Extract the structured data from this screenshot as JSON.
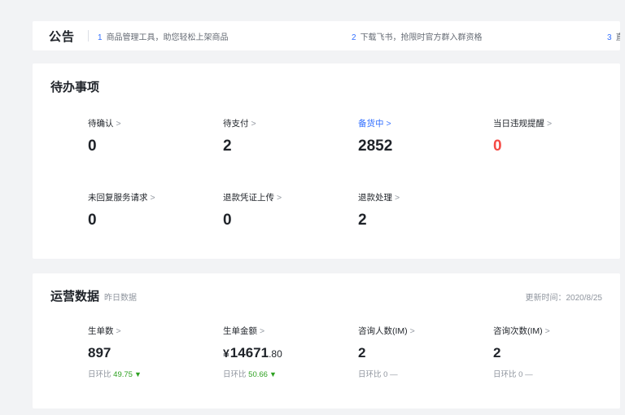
{
  "notice": {
    "title": "公告",
    "items": [
      {
        "num": "1",
        "text": "商品管理工具，助您轻松上架商品"
      },
      {
        "num": "2",
        "text": "下载飞书，抢限时官方群入群资格"
      },
      {
        "num": "3",
        "text": "直"
      }
    ]
  },
  "todo": {
    "title": "待办事项",
    "items": [
      {
        "label": "待确认",
        "value": "0"
      },
      {
        "label": "待支付",
        "value": "2"
      },
      {
        "label": "备货中",
        "value": "2852"
      },
      {
        "label": "当日违规提醒",
        "value": "0"
      },
      {
        "label": "未回复服务请求",
        "value": "0"
      },
      {
        "label": "退款凭证上传",
        "value": "0"
      },
      {
        "label": "退款处理",
        "value": "2"
      }
    ]
  },
  "ops": {
    "title": "运营数据",
    "subtitle": "昨日数据",
    "updated": "更新时间：2020/8/25",
    "ratio_label": "日环比",
    "items": [
      {
        "label": "生单数",
        "value": "897",
        "ratio": "49.75"
      },
      {
        "label": "生单金额",
        "currency": "¥",
        "value_int": "14671",
        "value_dec": ".80",
        "ratio": "50.66"
      },
      {
        "label": "咨询人数(IM)",
        "value": "2",
        "ratio": "0"
      },
      {
        "label": "咨询次数(IM)",
        "value": "2",
        "ratio": "0"
      }
    ]
  },
  "icons": {
    "chevron": "chevron-right-icon",
    "trend": "arrow-down-icon"
  },
  "colors": {
    "accent": "#3370ff",
    "alert": "#f54a45",
    "positive": "#2ea121"
  }
}
